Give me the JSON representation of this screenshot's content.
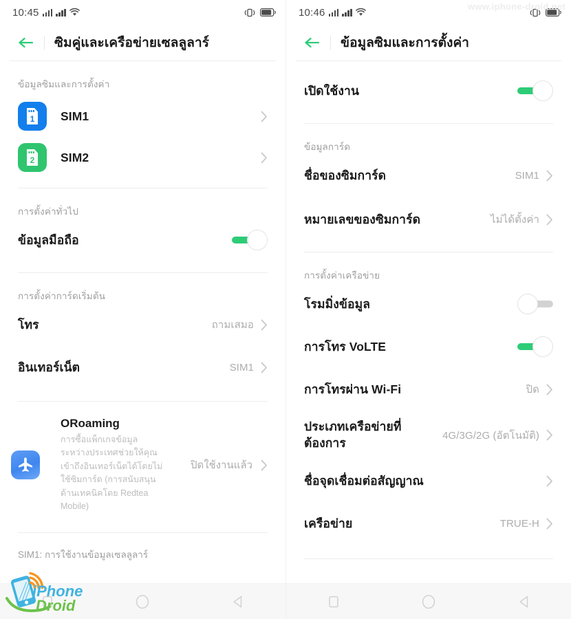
{
  "watermarks": {
    "top_right": "www.iphone-droid.net",
    "logo_line1": "iPhone",
    "logo_line2": "Droid"
  },
  "left_screen": {
    "statusbar": {
      "time": "10:45",
      "icons": [
        "signal-bars-icon",
        "signal-bars-icon",
        "wifi-icon",
        "vibrate-icon",
        "battery-icon"
      ]
    },
    "title": "ซิมคู่และเครือข่ายเซลลูลาร์",
    "back_icon": "back-arrow-icon",
    "groups": [
      {
        "label": "ข้อมูลซิมและการตั้งค่า",
        "rows": [
          {
            "icon": "sim1-card-icon",
            "label": "SIM1",
            "value": "",
            "type": "nav"
          },
          {
            "icon": "sim2-card-icon",
            "label": "SIM2",
            "value": "",
            "type": "nav"
          }
        ]
      },
      {
        "label": "การตั้งค่าทั่วไป",
        "rows": [
          {
            "label": "ข้อมูลมือถือ",
            "type": "toggle",
            "state": "on"
          }
        ]
      },
      {
        "label": "การตั้งค่าการ์ดเริ่มต้น",
        "rows": [
          {
            "label": "โทร",
            "value": "ถามเสมอ",
            "type": "nav"
          },
          {
            "label": "อินเทอร์เน็ต",
            "value": "SIM1",
            "type": "nav"
          }
        ]
      }
    ],
    "roaming": {
      "icon": "airplane-icon",
      "title": "ORoaming",
      "description": "การซื้อแพ็กเกจข้อมูลระหว่างประเทศช่วยให้คุณเข้าถึงอินเทอร์เน็ตได้โดยไม่ใช้ซิมการ์ด (การสนับสนุนด้านเทคนิคโดย Redtea Mobile)",
      "status": "ปิดใช้งานแล้ว"
    },
    "footer_label": "SIM1: การใช้งานข้อมูลเซลลูลาร์"
  },
  "right_screen": {
    "statusbar": {
      "time": "10:46",
      "icons": [
        "signal-bars-icon",
        "signal-bars-icon",
        "wifi-icon",
        "vibrate-icon",
        "battery-icon"
      ]
    },
    "title": "ข้อมูลซิมและการตั้งค่า",
    "back_icon": "back-arrow-icon",
    "enable_row": {
      "label": "เปิดใช้งาน",
      "type": "toggle",
      "state": "on"
    },
    "groups": [
      {
        "label": "ข้อมูลการ์ด",
        "rows": [
          {
            "label": "ชื่อของซิมการ์ด",
            "value": "SIM1",
            "type": "nav"
          },
          {
            "label": "หมายเลขของซิมการ์ด",
            "value": "ไม่ได้ตั้งค่า",
            "type": "nav"
          }
        ]
      },
      {
        "label": "การตั้งค่าเครือข่าย",
        "rows": [
          {
            "label": "โรมมิ่งข้อมูล",
            "type": "toggle",
            "state": "off"
          },
          {
            "label": "การโทร VoLTE",
            "type": "toggle",
            "state": "on"
          },
          {
            "label": "การโทรผ่าน Wi-Fi",
            "value": "ปิด",
            "type": "nav"
          },
          {
            "label": "ประเภทเครือข่ายที่ต้องการ",
            "value": "4G/3G/2G (อัตโนมัติ)",
            "type": "nav"
          },
          {
            "label": "ชื่อจุดเชื่อมต่อสัญญาณ",
            "value": "",
            "type": "nav"
          },
          {
            "label": "เครือข่าย",
            "value": "TRUE-H",
            "type": "nav"
          }
        ]
      }
    ]
  },
  "navbar": {
    "left": [
      {
        "icon": "recents-square-icon"
      },
      {
        "icon": "home-circle-icon"
      },
      {
        "icon": "back-triangle-icon"
      }
    ],
    "right": [
      {
        "icon": "recents-square-icon"
      },
      {
        "icon": "home-circle-icon"
      },
      {
        "icon": "back-triangle-icon"
      }
    ]
  },
  "colors": {
    "accent_green": "#2ecc77",
    "sim1_blue": "#127fec",
    "sim2_green": "#2fc56f",
    "roaming_blue": "#4f91f0",
    "label_gray": "#9e9e9e",
    "value_gray": "#adadad"
  }
}
